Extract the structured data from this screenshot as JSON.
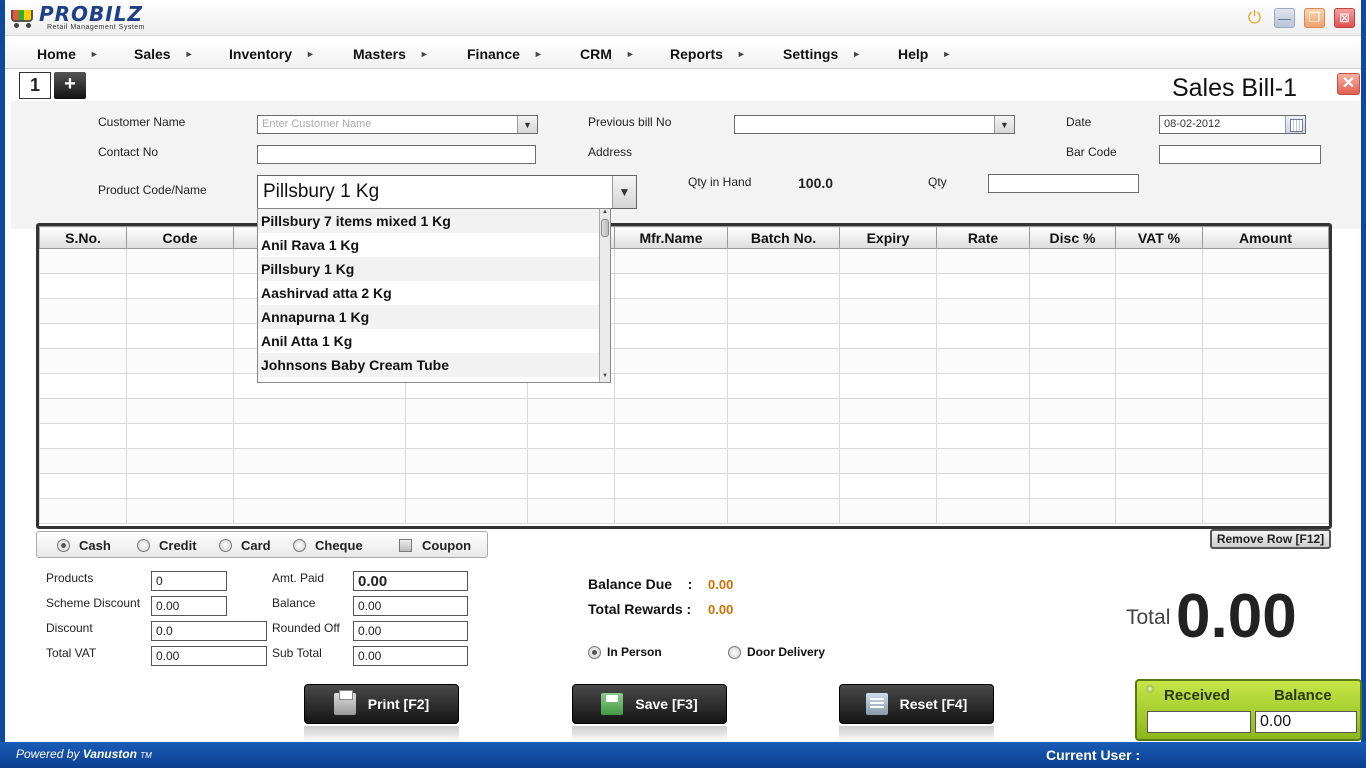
{
  "app": {
    "logo_name": "PROBILZ",
    "logo_subtitle": "Retail Management System"
  },
  "menu": {
    "items": [
      {
        "label": "Home"
      },
      {
        "label": "Sales"
      },
      {
        "label": "Inventory"
      },
      {
        "label": "Masters"
      },
      {
        "label": "Finance"
      },
      {
        "label": "CRM"
      },
      {
        "label": "Reports"
      },
      {
        "label": "Settings"
      },
      {
        "label": "Help"
      }
    ],
    "arrow": "►"
  },
  "tabs": {
    "current": "1",
    "add": "+"
  },
  "page": {
    "title": "Sales Bill-1",
    "close": "✕"
  },
  "form": {
    "customer_name_label": "Customer Name",
    "customer_name_placeholder": "Enter Customer Name",
    "previous_bill_label": "Previous bill No",
    "previous_bill_value": "",
    "date_label": "Date",
    "date_value": "08-02-2012",
    "contact_label": "Contact No",
    "contact_value": "",
    "address_label": "Address",
    "barcode_label": "Bar Code",
    "barcode_value": "",
    "product_label": "Product Code/Name",
    "product_value": "Pillsbury 1 Kg",
    "qty_hand_label": "Qty in Hand",
    "qty_hand_value": "100.0",
    "qty_label": "Qty",
    "qty_value": ""
  },
  "product_dropdown": {
    "items": [
      "Pillsbury 7 items mixed 1 Kg",
      "Anil Rava 1 Kg",
      "Pillsbury 1 Kg",
      "Aashirvad atta 2 Kg",
      "Annapurna 1 Kg",
      "Anil Atta 1 Kg",
      "Johnsons Baby Cream Tube"
    ]
  },
  "grid": {
    "columns": [
      "S.No.",
      "Code",
      "",
      "",
      "",
      "Mfr.Name",
      "Batch No.",
      "Expiry",
      "Rate",
      "Disc %",
      "VAT %",
      "Amount"
    ],
    "row_count": 11
  },
  "payment": {
    "options": [
      {
        "label": "Cash",
        "selected": true
      },
      {
        "label": "Credit",
        "selected": false
      },
      {
        "label": "Card",
        "selected": false
      },
      {
        "label": "Cheque",
        "selected": false
      }
    ],
    "coupon_label": "Coupon",
    "remove_row": "Remove Row  [F12]"
  },
  "summary": {
    "products_label": "Products",
    "products_value": "0",
    "scheme_discount_label": "Scheme Discount",
    "scheme_discount_value": "0.00",
    "discount_label": "Discount",
    "discount_value": "0.0",
    "total_vat_label": "Total VAT",
    "total_vat_value": "0.00",
    "amt_paid_label": "Amt. Paid",
    "amt_paid_value": "0.00",
    "balance_label": "Balance",
    "balance_value": "0.00",
    "rounded_off_label": "Rounded Off",
    "rounded_off_value": "0.00",
    "sub_total_label": "Sub Total",
    "sub_total_value": "0.00"
  },
  "balance_info": {
    "balance_due_label": "Balance Due    :",
    "balance_due_value": "0.00",
    "total_rewards_label": "Total Rewards :",
    "total_rewards_value": "0.00"
  },
  "delivery": {
    "in_person": "In Person",
    "door_delivery": "Door Delivery"
  },
  "total": {
    "label": "Total",
    "value": "0.00"
  },
  "actions": {
    "print": "Print  [F2]",
    "save": "Save  [F3]",
    "reset": "Reset  [F4]"
  },
  "received": {
    "received_label": "Received",
    "balance_label": "Balance",
    "received_value": "",
    "balance_value": "0.00"
  },
  "status": {
    "powered_by": "Powered by",
    "vendor": "Vanuston",
    "tm": "TM",
    "current_user_label": "Current User :"
  },
  "colors": {
    "accent_blue": "#0d4a9e",
    "value_orange": "#d07000",
    "received_green": "#8cb81c"
  }
}
